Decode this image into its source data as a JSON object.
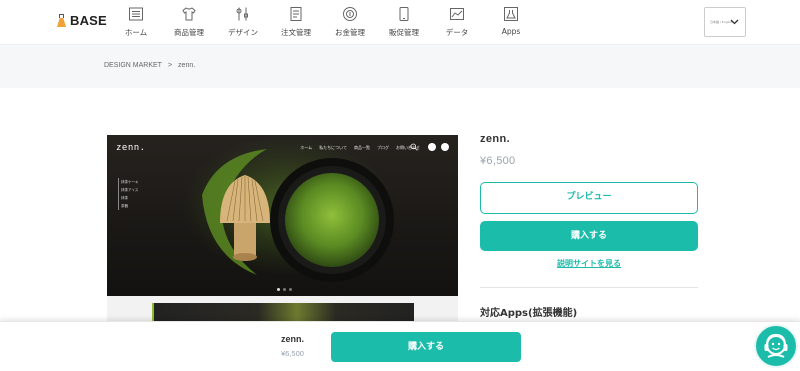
{
  "header": {
    "logo_text": "BASE",
    "nav": [
      {
        "label": "ホーム",
        "icon": "home-list-icon"
      },
      {
        "label": "商品管理",
        "icon": "tshirt-icon"
      },
      {
        "label": "デザイン",
        "icon": "design-tools-icon"
      },
      {
        "label": "注文管理",
        "icon": "order-doc-icon"
      },
      {
        "label": "お金管理",
        "icon": "money-icon"
      },
      {
        "label": "販促管理",
        "icon": "phone-icon"
      },
      {
        "label": "データ",
        "icon": "chart-icon"
      },
      {
        "label": "Apps",
        "icon": "flask-icon"
      }
    ],
    "language_select": {
      "value": "日本語 / English"
    }
  },
  "breadcrumb": {
    "root": "DESIGN MARKET",
    "separator": ">",
    "current": "zenn."
  },
  "preview_image": {
    "brand": "zenn.",
    "menu": [
      "ホーム",
      "私たちについて",
      "商品一覧",
      "ブログ",
      "お問い合わせ"
    ],
    "side_menu": [
      "抹茶ケーキ",
      "抹茶アイス",
      "抹茶",
      "茶器"
    ]
  },
  "product": {
    "name": "zenn.",
    "price": "¥6,500",
    "preview_label": "プレビュー",
    "buy_label": "購入する",
    "manual_link": "説明サイトを見る",
    "apps_heading": "対応Apps(拡張機能)"
  },
  "sticky_bar": {
    "name": "zenn.",
    "price": "¥6,500",
    "buy_label": "購入する"
  },
  "colors": {
    "accent": "#1bbcaa",
    "price_gray": "#9aa3ad",
    "band": "#f6f7f9"
  }
}
